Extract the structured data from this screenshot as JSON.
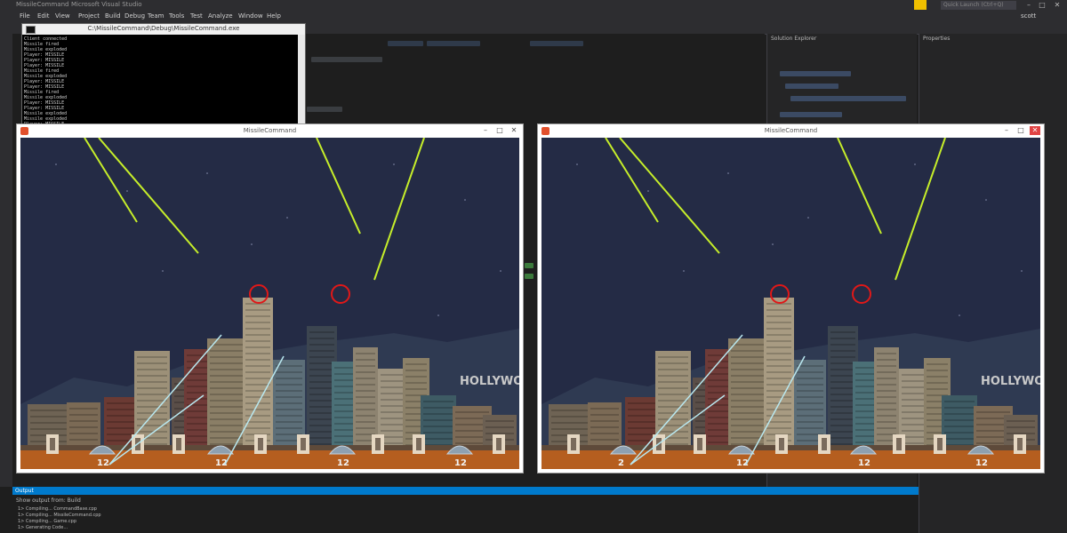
{
  "ide": {
    "title": "MissileCommand",
    "title_suffix": "Microsoft Visual Studio",
    "menu": [
      "File",
      "Edit",
      "View",
      "Project",
      "Build",
      "Debug",
      "Team",
      "Tools",
      "Test",
      "Analyze",
      "Window",
      "Help"
    ],
    "quick_launch_placeholder": "Quick Launch (Ctrl+Q)",
    "user": "scott",
    "solution_explorer_title": "Solution Explorer",
    "properties_title": "Properties",
    "output_title": "Output",
    "output_source": "Show output from:  Build",
    "output_lines": [
      "1>  Compiling...  CommandBase.cpp",
      "1>  Compiling...  MissileCommand.cpp",
      "1>  Compiling...  Game.cpp",
      "1>  Generating Code..."
    ]
  },
  "console": {
    "title": "C:\\MissileCommand\\Debug\\MissileCommand.exe",
    "lines": [
      "Client connected",
      "Missile fired",
      "Missile exploded",
      "Player: MISSILE",
      "Player: MISSILE",
      "Player: MISSILE",
      "Missile fired",
      "Missile exploded",
      "Player: MISSILE",
      "Player: MISSILE",
      "Missile fired",
      "Missile exploded",
      "Player: MISSILE",
      "Player: MISSILE",
      "Missile exploded",
      "Missile exploded",
      "Player: MISSILE",
      "Missile exploded"
    ]
  },
  "game_windows": [
    {
      "title": "MissileCommand",
      "ammo": [
        "12",
        "12",
        "12",
        "12"
      ],
      "city_sign": "HOLLYWOOD"
    },
    {
      "title": "MissileCommand",
      "ammo": [
        "2",
        "12",
        "12",
        "12"
      ],
      "city_sign": "HOLLYWOOD"
    }
  ],
  "colors": {
    "sky": "#242b45",
    "ground": "#b55e1f",
    "enemy_trail": "#c6ee2a",
    "player_trail": "#b9e8f0",
    "target_ring": "#e01818"
  }
}
